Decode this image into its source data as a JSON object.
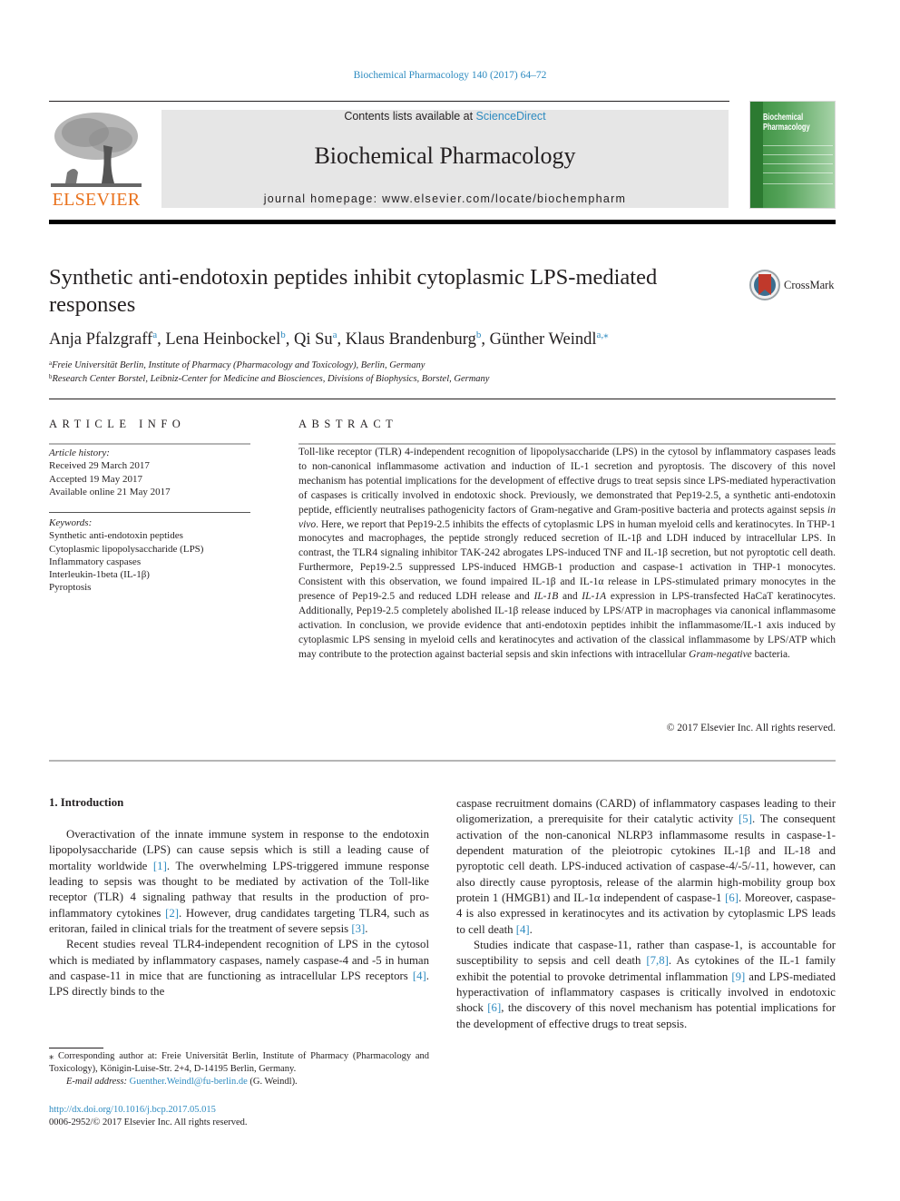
{
  "header": {
    "citation": "Biochemical Pharmacology 140 (2017) 64–72",
    "contents_prefix": "Contents lists available at ",
    "contents_link": "ScienceDirect",
    "journal_title": "Biochemical Pharmacology",
    "homepage": "journal homepage: www.elsevier.com/locate/biochempharm",
    "publisher_logo_text": "ELSEVIER",
    "cover_title_line1": "Biochemical",
    "cover_title_line2": "Pharmacology",
    "crossmark_label": "CrossMark"
  },
  "colors": {
    "link": "#2e8bc0",
    "elsevier_orange": "#e9711c",
    "cover_green": "#3a8f3e",
    "crossmark_red": "#c0392b"
  },
  "article": {
    "title": "Synthetic anti-endotoxin peptides inhibit cytoplasmic LPS-mediated responses",
    "authors": [
      {
        "name": "Anja Pfalzgraff",
        "sup": "a",
        "sep": ", "
      },
      {
        "name": "Lena Heinbockel",
        "sup": "b",
        "sep": ", "
      },
      {
        "name": "Qi Su",
        "sup": "a",
        "sep": ", "
      },
      {
        "name": "Klaus Brandenburg",
        "sup": "b",
        "sep": ", "
      },
      {
        "name": "Günther Weindl",
        "sup": "a,⁎",
        "sep": ""
      }
    ],
    "affiliations": [
      {
        "key": "a",
        "text": "Freie Universität Berlin, Institute of Pharmacy (Pharmacology and Toxicology), Berlin, Germany"
      },
      {
        "key": "b",
        "text": "Research Center Borstel, Leibniz-Center for Medicine and Biosciences, Divisions of Biophysics, Borstel, Germany"
      }
    ]
  },
  "article_info": {
    "heading": "ARTICLE INFO",
    "history_label": "Article history:",
    "received": "Received 29 March 2017",
    "accepted": "Accepted 19 May 2017",
    "available": "Available online 21 May 2017",
    "keywords_label": "Keywords:",
    "keywords": [
      "Synthetic anti-endotoxin peptides",
      "Cytoplasmic lipopolysaccharide (LPS)",
      "Inflammatory caspases",
      "Interleukin-1beta (IL-1β)",
      "Pyroptosis"
    ]
  },
  "abstract": {
    "heading": "ABSTRACT",
    "p1": "Toll-like receptor (TLR) 4-independent recognition of lipopolysaccharide (LPS) in the cytosol by inflammatory caspases leads to non-canonical inflammasome activation and induction of IL-1 secretion and pyroptosis. The discovery of this novel mechanism has potential implications for the development of effective drugs to treat sepsis since LPS-mediated hyperactivation of caspases is critically involved in endotoxic shock. Previously, we demonstrated that Pep19-2.5, a synthetic anti-endotoxin peptide, efficiently neutralises pathogenicity factors of Gram-negative and Gram-positive bacteria and protects against sepsis ",
    "in_vivo": "in vivo",
    "p2": ". Here, we report that Pep19-2.5 inhibits the effects of cytoplasmic LPS in human myeloid cells and keratinocytes. In THP-1 monocytes and macrophages, the peptide strongly reduced secretion of IL-1β and LDH induced by intracellular LPS. In contrast, the TLR4 signaling inhibitor TAK-242 abrogates LPS-induced TNF and IL-1β secretion, but not pyroptotic cell death. Furthermore, Pep19-2.5 suppressed LPS-induced HMGB-1 production and caspase-1 activation in THP-1 monocytes. Consistent with this observation, we found impaired IL-1β and IL-1α release in LPS-stimulated primary monocytes in the presence of Pep19-2.5 and reduced LDH release and ",
    "il1b": "IL-1B",
    "and": " and ",
    "il1a": "IL-1A",
    "p3": " expression in LPS-transfected HaCaT keratinocytes. Additionally, Pep19-2.5 completely abolished IL-1β release induced by LPS/ATP in macrophages via canonical inflammasome activation. In conclusion, we provide evidence that anti-endotoxin peptides inhibit the inflammasome/IL-1 axis induced by cytoplasmic LPS sensing in myeloid cells and keratinocytes and activation of the classical inflammasome by LPS/ATP which may contribute to the protection against bacterial sepsis and skin infections with intracellular ",
    "gram_negative": "Gram-negative",
    "p4": " bacteria.",
    "copyright": "© 2017 Elsevier Inc. All rights reserved."
  },
  "introduction": {
    "heading": "1. Introduction",
    "para1": [
      {
        "t": "Overactivation of the innate immune system in response to the endotoxin lipopolysaccharide (LPS) can cause sepsis which is still a leading cause of mortality worldwide "
      },
      {
        "ref": "[1]"
      },
      {
        "t": ". The overwhelming LPS-triggered immune response leading to sepsis was thought to be mediated by activation of the Toll-like receptor (TLR) 4 signaling pathway that results in the production of pro-inflammatory cytokines "
      },
      {
        "ref": "[2]"
      },
      {
        "t": ". However, drug candidates targeting TLR4, such as eritoran, failed in clinical trials for the treatment of severe sepsis "
      },
      {
        "ref": "[3]"
      },
      {
        "t": "."
      }
    ],
    "para2": [
      {
        "t": "Recent studies reveal TLR4-independent recognition of LPS in the cytosol which is mediated by inflammatory caspases, namely caspase-4 and -5 in human and caspase-11 in mice that are functioning as intracellular LPS receptors "
      },
      {
        "ref": "[4]"
      },
      {
        "t": ". LPS directly binds to the caspase recruitment domains (CARD) of inflammatory caspases leading to their oligomerization, a prerequisite for their catalytic activity "
      },
      {
        "ref": "[5]"
      },
      {
        "t": ". The consequent activation of the non-canonical NLRP3 inflammasome results in caspase-1-dependent maturation of the pleiotropic cytokines IL-1β and IL-18 and pyroptotic cell death. LPS-induced activation of caspase-4/-5/-11, however, can also directly cause pyroptosis, release of the alarmin high-mobility group box protein 1 (HMGB1) and IL-1α independent of caspase-1 "
      },
      {
        "ref": "[6]"
      },
      {
        "t": ". Moreover, caspase-4 is also expressed in keratinocytes and its activation by cytoplasmic LPS leads to cell death "
      },
      {
        "ref": "[4]"
      },
      {
        "t": "."
      }
    ],
    "para3": [
      {
        "t": "Studies indicate that caspase-11, rather than caspase-1, is accountable for susceptibility to sepsis and cell death "
      },
      {
        "ref": "[7,8]"
      },
      {
        "t": ". As cytokines of the IL-1 family exhibit the potential to provoke detrimental inflammation "
      },
      {
        "ref": "[9]"
      },
      {
        "t": " and LPS-mediated hyperactivation of inflammatory caspases is critically involved in endotoxic shock "
      },
      {
        "ref": "[6]"
      },
      {
        "t": ", the discovery of this novel mechanism has potential implications for the development of effective drugs to treat sepsis."
      }
    ]
  },
  "footnote": {
    "corresponding": "⁎ Corresponding author at: Freie Universität Berlin, Institute of Pharmacy (Pharmacology and Toxicology), Königin-Luise-Str. 2+4, D-14195 Berlin, Germany.",
    "email_label": "E-mail address: ",
    "email": "Guenther.Weindl@fu-berlin.de",
    "email_suffix": " (G. Weindl).",
    "doi": "http://dx.doi.org/10.1016/j.bcp.2017.05.015",
    "issn": "0006-2952/© 2017 Elsevier Inc. All rights reserved."
  }
}
